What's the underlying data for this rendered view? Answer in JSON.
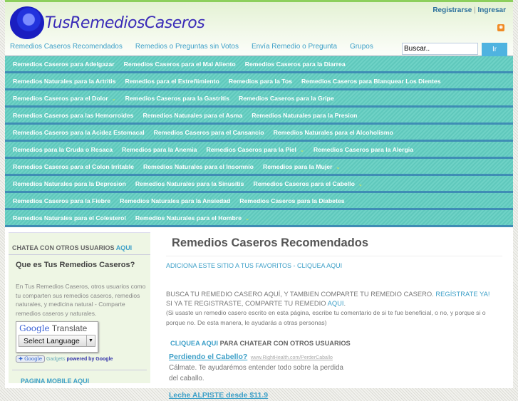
{
  "header": {
    "logo_text": "TusRemediosCaseros",
    "register": "Registrarse",
    "separator": "|",
    "login": "Ingresar",
    "rss_icon": "rss-icon",
    "nav": [
      "Remedios Caseros Recomendados",
      "Remedios o Preguntas sin Votos",
      "Envía Remedio o Pregunta",
      "Grupos"
    ],
    "search_placeholder": "Buscar..",
    "search_button": "Ir"
  },
  "categories": [
    [
      {
        "label": "Remedios Caseros para Adelgazar"
      },
      {
        "label": "Remedios Caseros para el Mal Aliento"
      },
      {
        "label": "Remedios Caseros para la Diarrea"
      }
    ],
    [
      {
        "label": "Remedios Naturales para la Artritis"
      },
      {
        "label": "Remedios para el Estreñimiento"
      },
      {
        "label": "Remedios para la Tos"
      },
      {
        "label": "Remedios Caseros para Blanquear Los Dientes"
      }
    ],
    [
      {
        "label": "Remedios Caseros para el Dolor",
        "sub": true
      },
      {
        "label": "Remedios Caseros para la Gastritis"
      },
      {
        "label": "Remedios Caseros para la Gripe"
      }
    ],
    [
      {
        "label": "Remedios Caseros para las Hemorroides"
      },
      {
        "label": "Remedios Naturales para el Asma"
      },
      {
        "label": "Remedios Naturales para la Presion"
      }
    ],
    [
      {
        "label": "Remedios Caseros para la Acidez Estomacal"
      },
      {
        "label": "Remedios Caseros para el Cansancio"
      },
      {
        "label": "Remedios Naturales para el Alcoholismo"
      }
    ],
    [
      {
        "label": "Remedios para la Cruda o Resaca"
      },
      {
        "label": "Remedios para la Anemia"
      },
      {
        "label": "Remedios Caseros para la Piel",
        "sub": true
      },
      {
        "label": "Remedios Caseros para la Alergia"
      }
    ],
    [
      {
        "label": "Remedios Caseros para el Colon Irritable"
      },
      {
        "label": "Remedios Naturales para el Insomnio"
      },
      {
        "label": "Remedios para la Mujer",
        "sub": true
      }
    ],
    [
      {
        "label": "Remedios Naturales para la Depresion"
      },
      {
        "label": "Remedios Naturales para la Sinusitis"
      },
      {
        "label": "Remedios Caseros para el Cabello",
        "sub": true
      }
    ],
    [
      {
        "label": "Remedios Caseros para la Fiebre"
      },
      {
        "label": "Remedios Naturales para la Ansiedad"
      },
      {
        "label": "Remedios Caseros para la Diabetes"
      }
    ],
    [
      {
        "label": "Remedios Naturales para el Colesterol"
      },
      {
        "label": "Remedios Naturales para el Hombre",
        "sub": true
      }
    ]
  ],
  "sidebar": {
    "chat_label": "CHATEA CON OTROS USUARIOS",
    "chat_link": "AQUI",
    "title": "Que es Tus Remedios Caseros?",
    "text": "En Tus Remedios Caseros, otros usuarios como tu comparten sus remedios caseros, remedios naturales, y medicina natural - Comparte remedios caseros y naturales.",
    "translate_google": "Google",
    "translate_label": "Translate",
    "select_language": "Select Language",
    "gadgets_google": "Google",
    "gadgets": "Gadgets",
    "powered": "powered by Google",
    "mobile_label": "PAGINA MOBILE",
    "mobile_link": "AQUI"
  },
  "main": {
    "title": "Remedios Caseros Recomendados",
    "fav_text": "ADICIONA ESTE SITIO A TUS FAVORITOS - ",
    "fav_link": "CLIQUEA AQUI",
    "intro1": "BUSCA TU REMEDIO CASERO AQUÍ, Y TAMBIEN COMPARTE TU REMEDIO CASERO. ",
    "register_link": "REGÍSTRATE YA!",
    "intro2": "SI YA TE REGISTRASTE, COMPARTE TU REMEDIO ",
    "aqui_link": "AQUI",
    "period": ".",
    "note": "(Si usaste un remedio casero escrito en esta página, escribe tu comentario de si te fue beneficial, o no, y porque si o porque no. De esta manera, le ayudarás a otras personas)",
    "chat_link": "CLIQUEA AQUI",
    "chat_text": " PARA CHATEAR CON OTROS USUARIOS",
    "ads": [
      {
        "title": "Perdiendo el Cabello?",
        "url": "www.RightHealth.com/PerderCaballo",
        "desc": "Cálmate. Te ayudarémos entender todo sobre la perdida del caballo."
      },
      {
        "title": "Leche ALPISTE desde $11.9"
      }
    ]
  }
}
